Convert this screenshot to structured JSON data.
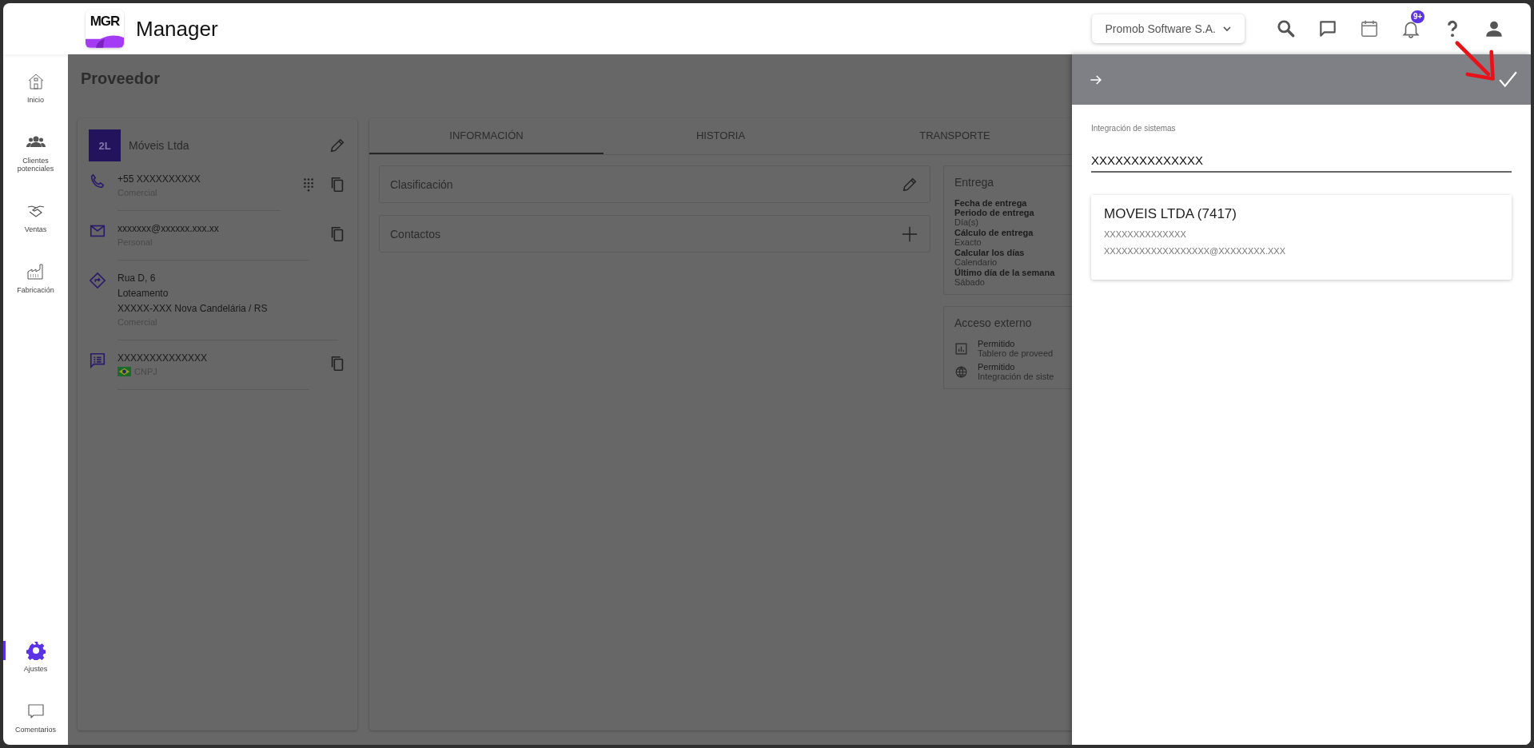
{
  "header": {
    "logo_text": "MGR",
    "app_name": "Manager",
    "company": "Promob Software S.A.",
    "notification_badge": "9+"
  },
  "sidebar": {
    "items": [
      {
        "label": "Inicio",
        "kind": "home",
        "selected": false
      },
      {
        "label": "Clientes potenciales",
        "kind": "people",
        "selected": false
      },
      {
        "label": "Ventas",
        "kind": "handshake",
        "selected": false
      },
      {
        "label": "Fabricación",
        "kind": "factory",
        "selected": false
      },
      {
        "label": "Ajustes",
        "kind": "gear",
        "selected": true
      },
      {
        "label": "Comentarios",
        "kind": "comment",
        "selected": false
      }
    ]
  },
  "page": {
    "title": "Proveedor"
  },
  "supplier_card": {
    "avatar": "2L",
    "name": "Móveis Ltda",
    "rows": [
      {
        "kind": "phone",
        "lines": [
          "+55 XXXXXXXXXX"
        ],
        "caption": "Comercial"
      },
      {
        "kind": "email",
        "lines": [
          "xxxxxxx@xxxxxx.xxx.xx"
        ],
        "caption": "Personal"
      },
      {
        "kind": "address",
        "lines": [
          "Rua D, 6",
          "Loteamento",
          "XXXXX-XXX Nova Candelária / RS"
        ],
        "caption": "Comercial"
      },
      {
        "kind": "document",
        "lines": [
          "XXXXXXXXXXXXXX"
        ],
        "caption": "CNPJ"
      }
    ]
  },
  "tabs": [
    {
      "label": "INFORMACIÓN",
      "selected": true
    },
    {
      "label": "HISTORIA",
      "selected": false
    },
    {
      "label": "TRANSPORTE",
      "selected": false
    }
  ],
  "sections": [
    {
      "title": "Clasificación",
      "kind": "edit"
    },
    {
      "title": "Contactos",
      "kind": "add"
    }
  ],
  "delivery": {
    "title": "Entrega",
    "fields": [
      {
        "label": "Fecha de entrega"
      },
      {
        "label": "Periodo de entrega",
        "value": "Día(s)"
      },
      {
        "label": "Cálculo de entrega",
        "value": "Exacto"
      },
      {
        "label": "Calcular los días",
        "value": "Calendario"
      },
      {
        "label": "Último día de la semana",
        "value": "Sábado"
      }
    ]
  },
  "external_access": {
    "title": "Acceso externo",
    "items": [
      {
        "kind": "chart",
        "status": "Permitido",
        "text": "Tablero de proveed"
      },
      {
        "kind": "globe",
        "status": "Permitido",
        "text": "Integración de siste"
      }
    ]
  },
  "panel": {
    "field_label": "Integración de sistemas",
    "field_value": "XXXXXXXXXXXXXX",
    "result": {
      "title": "MOVEIS LTDA (7417)",
      "lines": [
        "XXXXXXXXXXXXXX",
        "XXXXXXXXXXXXXXXXXX@XXXXXXXX.XXX"
      ]
    }
  }
}
